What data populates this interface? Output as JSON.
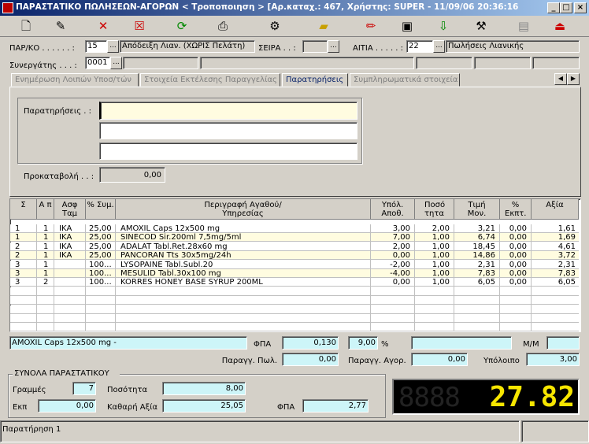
{
  "window": {
    "title": "ΠΑΡΑΣΤΑΤΙΚΟ ΠΩΛΗΣΕΩΝ-ΑΓΟΡΩΝ < Τροποποιηση > [Αρ.καταχ.: 467, Χρήστης: SUPER - 11/09/06 20:36:16 tt ]",
    "minimize": "_",
    "maximize": "□",
    "close": "×"
  },
  "header": {
    "parko_label": "ΠΑΡ/ΚΟ . . . . . . :",
    "parko_code": "15",
    "parko_desc": "Απόδειξη Λιαν. (ΧΩΡΙΣ Πελάτη)",
    "seira_label": "ΣΕΙΡΑ . . :",
    "seira_value": "",
    "aitia_label": "ΑΙΤΙΑ . . . . . :",
    "aitia_code": "22",
    "aitia_desc": "Πωλήσεις Λιανικής",
    "synergatis_label": "Συνεργάτης . . . :",
    "synergatis_code": "0001",
    "browse": "..."
  },
  "tabs": [
    {
      "label": "Ενημέρωση Λοιπών Υποσ/τών"
    },
    {
      "label": "Στοιχεία Εκτέλεσης Παραγγελίας"
    },
    {
      "label": "Παρατηρήσεις"
    },
    {
      "label": "Συμπληρωματικά στοιχεία"
    }
  ],
  "notes_panel": {
    "notes_label": "Παρατηρήσεις . :",
    "line1": "",
    "line2": "",
    "line3": "",
    "deposit_label": "Προκαταβολή . . :",
    "deposit_value": "0,00"
  },
  "table": {
    "columns": [
      "Σ",
      "Α π",
      "Ασφ Ταμ",
      "% Συμ.",
      "Περιγραφή Αγαθού/Υπηρεσίας",
      "Υπόλ. Αποθ.",
      "Ποσό τητα",
      "Τιμή Μον.",
      "% Εκπτ.",
      "Αξία"
    ],
    "rows": [
      [
        "1",
        "1",
        "ΙΚΑ",
        "25,00",
        "AMOXIL Caps 12x500 mg",
        "3,00",
        "2,00",
        "3,21",
        "0,00",
        "1,61"
      ],
      [
        "1",
        "1",
        "ΙΚΑ",
        "25,00",
        "SINECOD Sir.200ml 7,5mg/5ml",
        "7,00",
        "1,00",
        "6,74",
        "0,00",
        "1,69"
      ],
      [
        "2",
        "1",
        "ΙΚΑ",
        "25,00",
        "ADALAT Tabl.Ret.28x60 mg",
        "2,00",
        "1,00",
        "18,45",
        "0,00",
        "4,61"
      ],
      [
        "2",
        "1",
        "ΙΚΑ",
        "25,00",
        "PANCORAN  Tts 30x5mg/24h",
        "0,00",
        "1,00",
        "14,86",
        "0,00",
        "3,72"
      ],
      [
        "3",
        "1",
        "",
        "100...",
        "LYSOPAINE Tabl.Subl.20",
        "-2,00",
        "1,00",
        "2,31",
        "0,00",
        "2,31"
      ],
      [
        "3",
        "1",
        "",
        "100...",
        "MESULID  Tabl.30x100 mg",
        "-4,00",
        "1,00",
        "7,83",
        "0,00",
        "7,83"
      ],
      [
        "3",
        "2",
        "",
        "100...",
        "KORRES HONEY BASE SYRUP 200ML",
        "0,00",
        "1,00",
        "6,05",
        "0,00",
        "6,05"
      ]
    ]
  },
  "details": {
    "selected_item": "AMOXIL Caps 12x500 mg -",
    "fpa_label": "ΦΠΑ",
    "fpa_amount": "0,130",
    "fpa_rate": "9,00",
    "percent": "%",
    "mm_label": "Μ/Μ",
    "parag_pol_label": "Παραγγ. Πωλ.",
    "parag_pol_value": "0,00",
    "parag_agor_label": "Παραγγ. Αγορ.",
    "parag_agor_value": "0,00",
    "ypoloipo_label": "Υπόλοιπο",
    "ypoloipo_value": "3,00"
  },
  "totals": {
    "group_label": "ΣΥΝΟΛΑ ΠΑΡΑΣΤΑΤΙΚΟΥ",
    "grammes_label": "Γραμμές",
    "grammes_value": "7",
    "posotita_label": "Ποσότητα",
    "posotita_value": "8,00",
    "ekp_label": "Εκπ",
    "ekp_value": "0,00",
    "kathari_label": "Καθαρή Αξία",
    "kathari_value": "25,05",
    "fpa_label": "ΦΠΑ",
    "fpa_value": "2,77",
    "display_value": "27.82",
    "display_color": "#f7e600"
  },
  "statusbar": {
    "text": "Παρατήρηση 1"
  }
}
